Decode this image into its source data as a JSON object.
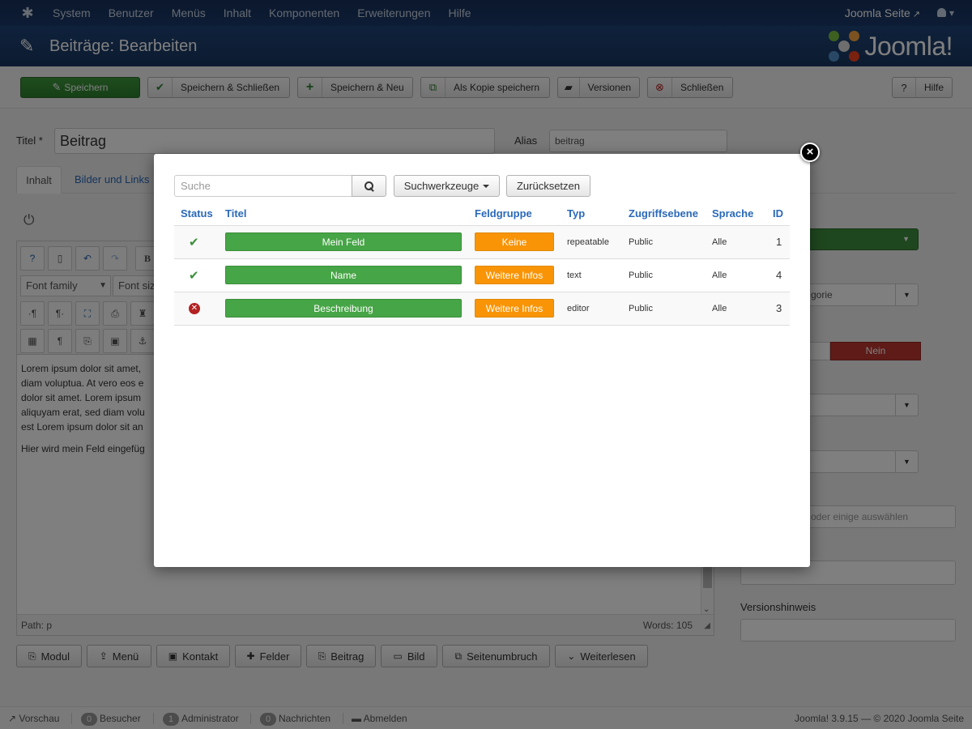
{
  "topbar": {
    "menu": [
      "System",
      "Benutzer",
      "Menüs",
      "Inhalt",
      "Komponenten",
      "Erweiterungen",
      "Hilfe"
    ],
    "site_link": "Joomla Seite"
  },
  "header": {
    "title": "Beiträge: Bearbeiten",
    "brand": "Joomla!"
  },
  "toolbar": {
    "save": "Speichern",
    "save_close": "Speichern & Schließen",
    "save_new": "Speichern & Neu",
    "save_copy": "Als Kopie speichern",
    "versions": "Versionen",
    "close": "Schließen",
    "help": "Hilfe"
  },
  "form": {
    "title_label": "Titel *",
    "title_value": "Beitrag",
    "alias_label": "Alias",
    "alias_value": "beitrag",
    "tabs": [
      "Inhalt",
      "Bilder und Links"
    ]
  },
  "editor": {
    "font_family": "Font family",
    "font_size": "Font siz",
    "body_lines": [
      "Lorem ipsum dolor sit amet,",
      "diam voluptua. At vero eos e",
      "dolor sit amet. Lorem ipsum",
      "aliquyam erat, sed diam volu",
      "est Lorem ipsum dolor sit an"
    ],
    "body_line2": "Hier wird mein Feld eingefüg",
    "path": "Path:  p",
    "words": "Words: 105"
  },
  "editor_buttons": [
    "Modul",
    "Menü",
    "Kontakt",
    "Felder",
    "Beitrag",
    "Bild",
    "Seitenumbruch",
    "Weiterlesen"
  ],
  "right_column": {
    "toggle_no": "Nein",
    "category_partial": "gorie",
    "tags_placeholder": "oder einige auswählen",
    "version_note_label": "Versionshinweis"
  },
  "modal": {
    "search_placeholder": "Suche",
    "search_tools": "Suchwerkzeuge",
    "reset": "Zurücksetzen",
    "columns": [
      "Status",
      "Titel",
      "Feldgruppe",
      "Typ",
      "Zugriffsebene",
      "Sprache",
      "ID"
    ],
    "rows": [
      {
        "status": "published",
        "title": "Mein Feld",
        "group": "Keine",
        "type": "repeatable",
        "access": "Public",
        "language": "Alle",
        "id": "1"
      },
      {
        "status": "published",
        "title": "Name",
        "group": "Weitere Infos",
        "type": "text",
        "access": "Public",
        "language": "Alle",
        "id": "4"
      },
      {
        "status": "unpublished",
        "title": "Beschreibung",
        "group": "Weitere Infos",
        "type": "editor",
        "access": "Public",
        "language": "Alle",
        "id": "3"
      }
    ]
  },
  "footer": {
    "preview": "Vorschau",
    "visitors_count": "0",
    "visitors": "Besucher",
    "admin_count": "1",
    "admin": "Administrator",
    "messages_count": "0",
    "messages": "Nachrichten",
    "logout": "Abmelden",
    "version": "Joomla! 3.9.15",
    "copyright": "— © 2020 Joomla Seite"
  },
  "colors": {
    "navbar": "#1a3867",
    "header": "#1c3d6e",
    "success": "#46a546",
    "warning": "#f89406",
    "danger": "#b32222",
    "link": "#2a69b8"
  }
}
